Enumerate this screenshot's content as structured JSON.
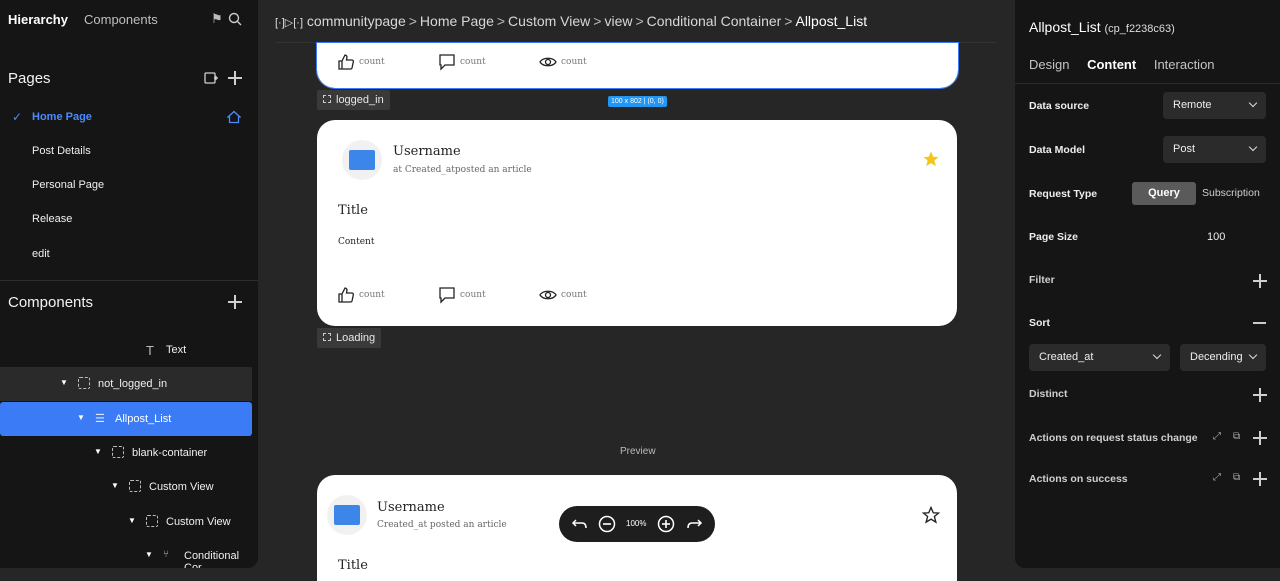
{
  "left": {
    "tab_hierarchy": "Hierarchy",
    "tab_components": "Components",
    "pages_title": "Pages",
    "pages": [
      "Home Page",
      "Post Details",
      "Personal Page",
      "Release",
      "edit"
    ],
    "components_title": "Components",
    "tree": [
      {
        "label": "Text"
      },
      {
        "label": "not_logged_in"
      },
      {
        "label": "Allpost_List"
      },
      {
        "label": "blank-container"
      },
      {
        "label": "Custom View"
      },
      {
        "label": "Custom View"
      },
      {
        "label": "Conditional Cor"
      }
    ]
  },
  "breadcrumb": {
    "prefix": "[·]▷[·]",
    "items": [
      "communitypage",
      "Home Page",
      "Custom View",
      "view",
      "Conditional Container",
      "Allpost_List"
    ],
    "separator": ">"
  },
  "canvas": {
    "action_label": "count",
    "tag_logged_in": "logged_in",
    "tag_loading": "Loading",
    "dim_badge": "100 x 802 | (0, 0)",
    "card1": {
      "username": "Username",
      "subline": "at Created_atposted an article",
      "title": "Title",
      "content": "Content"
    },
    "preview_label": "Preview",
    "preview_card": {
      "username": "Username",
      "subline": "Created_at posted an article",
      "title": "Title"
    },
    "zoom_level": "100%"
  },
  "right": {
    "title": "Allpost_List",
    "id": "(cp_f2238c63)",
    "tabs": [
      "Design",
      "Content",
      "Interaction"
    ],
    "data_source_label": "Data source",
    "data_source_value": "Remote",
    "data_model_label": "Data Model",
    "data_model_value": "Post",
    "request_type_label": "Request Type",
    "request_type_on": "Query",
    "request_type_off": "Subscription",
    "page_size_label": "Page Size",
    "page_size_value": "100",
    "filter_label": "Filter",
    "sort_label": "Sort",
    "sort_field": "Created_at",
    "sort_order": "Decending",
    "distinct_label": "Distinct",
    "actions_status_label": "Actions on request status change",
    "actions_success_label": "Actions on success"
  },
  "colors": {
    "accent": "#3b7bf6",
    "star": "#f5c518",
    "panel": "#151515",
    "canvas_bg": "#262626"
  }
}
